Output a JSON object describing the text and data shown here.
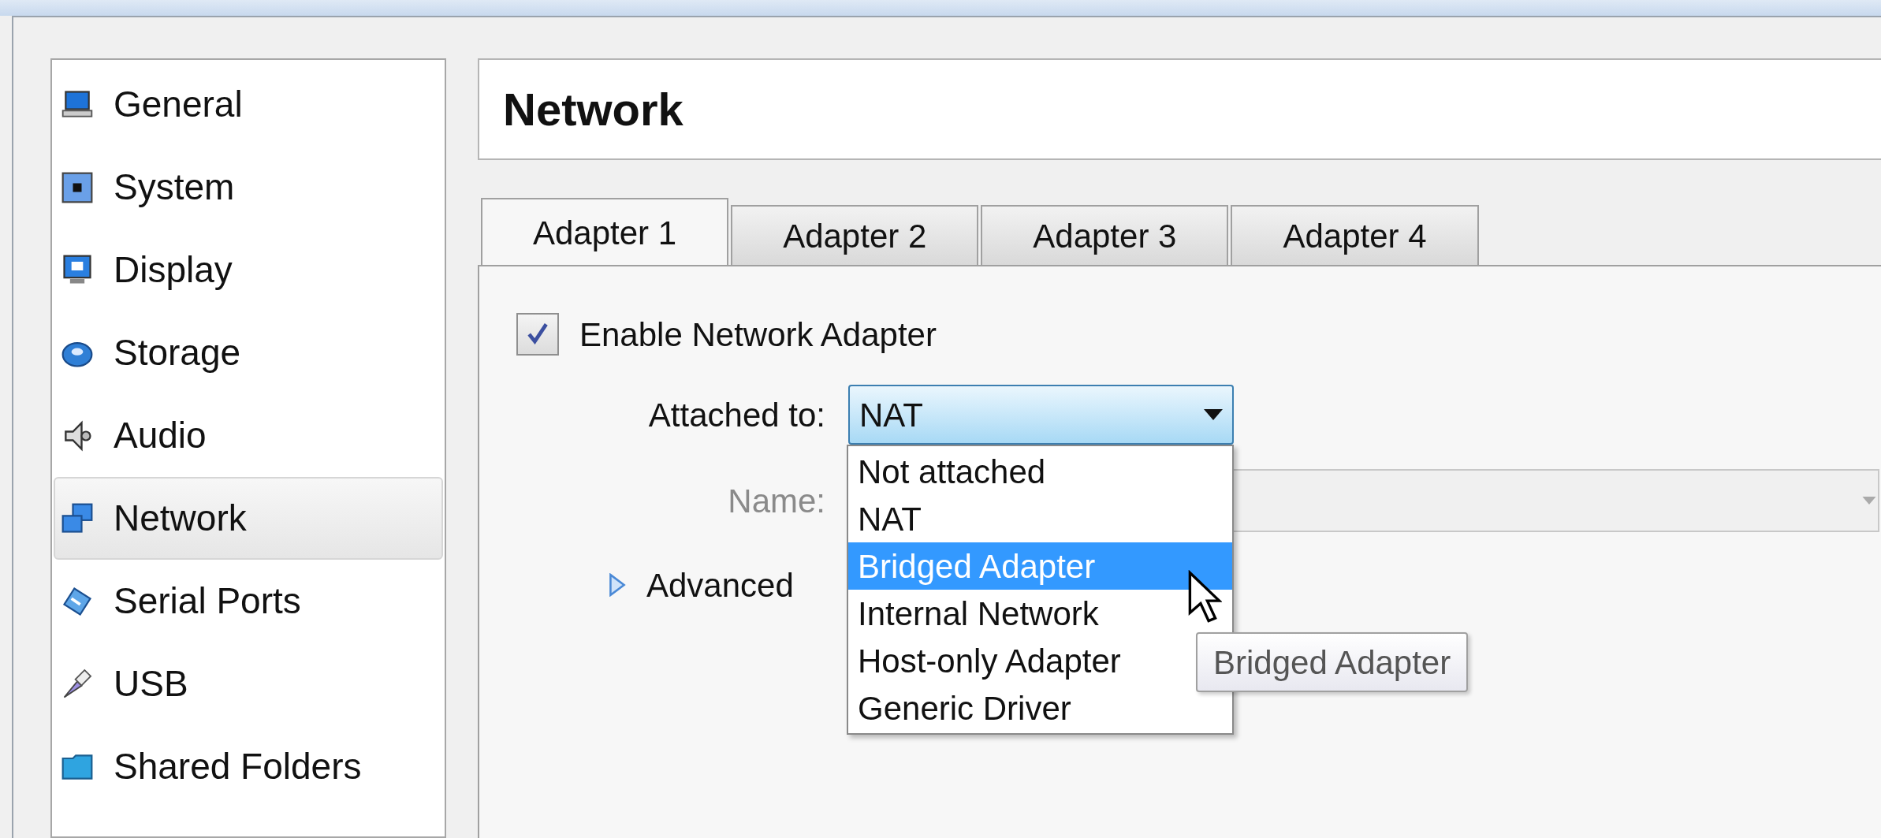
{
  "sidebar": {
    "items": [
      {
        "label": "General",
        "selected": false
      },
      {
        "label": "System",
        "selected": false
      },
      {
        "label": "Display",
        "selected": false
      },
      {
        "label": "Storage",
        "selected": false
      },
      {
        "label": "Audio",
        "selected": false
      },
      {
        "label": "Network",
        "selected": true
      },
      {
        "label": "Serial Ports",
        "selected": false
      },
      {
        "label": "USB",
        "selected": false
      },
      {
        "label": "Shared Folders",
        "selected": false
      }
    ]
  },
  "page_title": "Network",
  "tabs": [
    {
      "label": "Adapter 1",
      "selected": true
    },
    {
      "label": "Adapter 2",
      "selected": false
    },
    {
      "label": "Adapter 3",
      "selected": false
    },
    {
      "label": "Adapter 4",
      "selected": false
    }
  ],
  "enable_checkbox": {
    "label": "Enable Network Adapter",
    "checked": true
  },
  "attached_to": {
    "label": "Attached to:",
    "value": "NAT",
    "expanded": true,
    "options": [
      {
        "label": "Not attached",
        "highlighted": false
      },
      {
        "label": "NAT",
        "highlighted": false
      },
      {
        "label": "Bridged Adapter",
        "highlighted": true
      },
      {
        "label": "Internal Network",
        "highlighted": false
      },
      {
        "label": "Host-only Adapter",
        "highlighted": false
      },
      {
        "label": "Generic Driver",
        "highlighted": false
      }
    ]
  },
  "name_field": {
    "label": "Name:",
    "disabled": true
  },
  "advanced": {
    "label": "Advanced",
    "expanded": false
  },
  "tooltip": "Bridged Adapter"
}
